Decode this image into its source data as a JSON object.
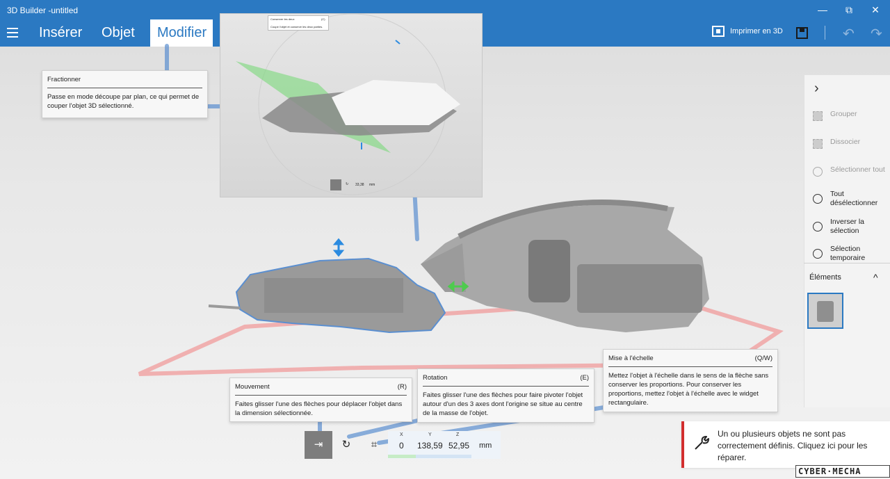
{
  "window": {
    "title": "3D Builder -untitled"
  },
  "window_controls": {
    "minimize": "—",
    "maximize": "⧉",
    "close": "✕"
  },
  "ribbon": {
    "tabs": [
      {
        "label": "Insérer"
      },
      {
        "label": "Objet"
      },
      {
        "label": "Modifier"
      }
    ],
    "active_tab": "Modifier",
    "print_label": "Imprimer en 3D",
    "undo_glyph": "↶",
    "redo_glyph": "↷"
  },
  "side_panel": {
    "collapse_glyph": "›",
    "items": [
      {
        "label": "Grouper",
        "enabled": false
      },
      {
        "label": "Dissocier",
        "enabled": false
      },
      {
        "label": "Sélectionner tout",
        "enabled": false
      },
      {
        "label": "Tout désélectionner",
        "enabled": true
      },
      {
        "label": "Inverser la sélection",
        "enabled": true
      },
      {
        "label": "Sélection temporaire",
        "enabled": true
      }
    ],
    "elements_title": "Éléments",
    "elements_toggle": "^"
  },
  "inset_preview": {
    "menu_items": [
      {
        "label": "Conserver les deux",
        "key": "(C)"
      },
      {
        "label": "Coupe l'objet et conserve les deux parties."
      }
    ],
    "measure_value": "33,38",
    "measure_unit": "mm"
  },
  "tooltips": {
    "fractionner": {
      "title": "Fractionner",
      "body": "Passe en mode découpe par plan, ce qui permet de couper l'objet 3D sélectionné."
    },
    "mouvement": {
      "title": "Mouvement",
      "shortcut": "(R)",
      "body": "Faites glisser l'une des flèches pour déplacer l'objet dans la dimension sélectionnée."
    },
    "rotation": {
      "title": "Rotation",
      "shortcut": "(E)",
      "body": "Faites glisser l'une des flèches pour faire pivoter l'objet autour d'un des 3 axes dont l'origine se situe au centre de la masse de l'objet."
    },
    "echelle": {
      "title": "Mise à l'échelle",
      "shortcut": "(Q/W)",
      "body": "Mettez l'objet à l'échelle dans le sens de la flèche sans conserver les proportions. Pour conserver les proportions, mettez l'objet à l'échelle avec le widget rectangulaire."
    }
  },
  "transform_bar": {
    "tools": [
      {
        "name": "move",
        "glyph": "⇥",
        "active": true
      },
      {
        "name": "rotate",
        "glyph": "↻",
        "active": false
      },
      {
        "name": "scale",
        "glyph": "⌗",
        "active": false
      }
    ],
    "coords": [
      {
        "axis": "X",
        "value": "0"
      },
      {
        "axis": "Y",
        "value": "138,59"
      },
      {
        "axis": "Z",
        "value": "52,95"
      }
    ],
    "unit": "mm"
  },
  "notification": {
    "text": "Un ou plusieurs objets ne sont pas correctement définis. Cliquez ici pour les réparer."
  },
  "watermark": "CYBER·MECHA",
  "colors": {
    "accent": "#2b79c2",
    "error": "#d22e2e",
    "callout_line": "#5b8fd0"
  }
}
